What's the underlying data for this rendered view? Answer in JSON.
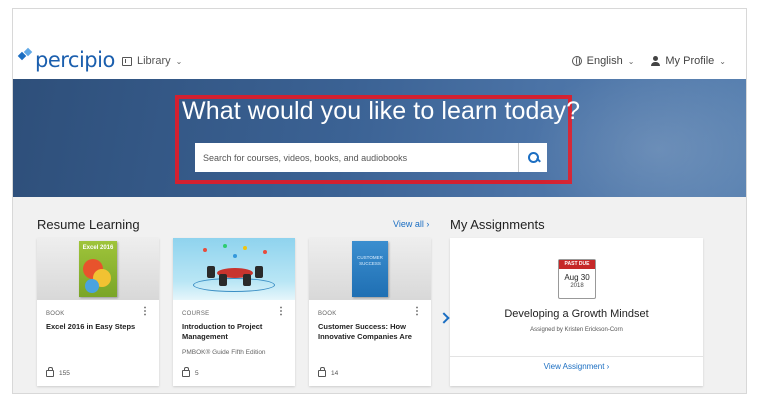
{
  "header": {
    "logo_text": "percipio",
    "library_label": "Library",
    "language_label": "English",
    "profile_label": "My Profile"
  },
  "hero": {
    "title": "What would you like to learn today?",
    "search_placeholder": "Search for courses, videos, books, and audiobooks",
    "highlight_color": "#d32030"
  },
  "resume_learning": {
    "title": "Resume Learning",
    "view_all": "View all ›",
    "cards": [
      {
        "type": "BOOK",
        "title": "Excel 2016 in Easy Steps",
        "subtitle": "",
        "likes": "155",
        "cover_text": "Excel 2016"
      },
      {
        "type": "COURSE",
        "title": "Introduction to Project Management",
        "subtitle": "PMBOK® Guide Fifth Edition",
        "likes": "5"
      },
      {
        "type": "BOOK",
        "title": "Customer Success: How Innovative Companies Are",
        "subtitle": "",
        "likes": "14",
        "cover_text": "CUSTOMER SUCCESS"
      }
    ]
  },
  "assignments": {
    "title": "My Assignments",
    "badge": "PAST DUE",
    "date": "Aug 30",
    "year": "2018",
    "assignment_title": "Developing a Growth Mindset",
    "assigned_by": "Assigned by Kristen Erickson-Corn",
    "view_label": "View Assignment ›"
  },
  "colors": {
    "brand": "#1b5fae",
    "link": "#1b6ec2",
    "hero_bg": "#3b6294",
    "past_due": "#c62828"
  }
}
